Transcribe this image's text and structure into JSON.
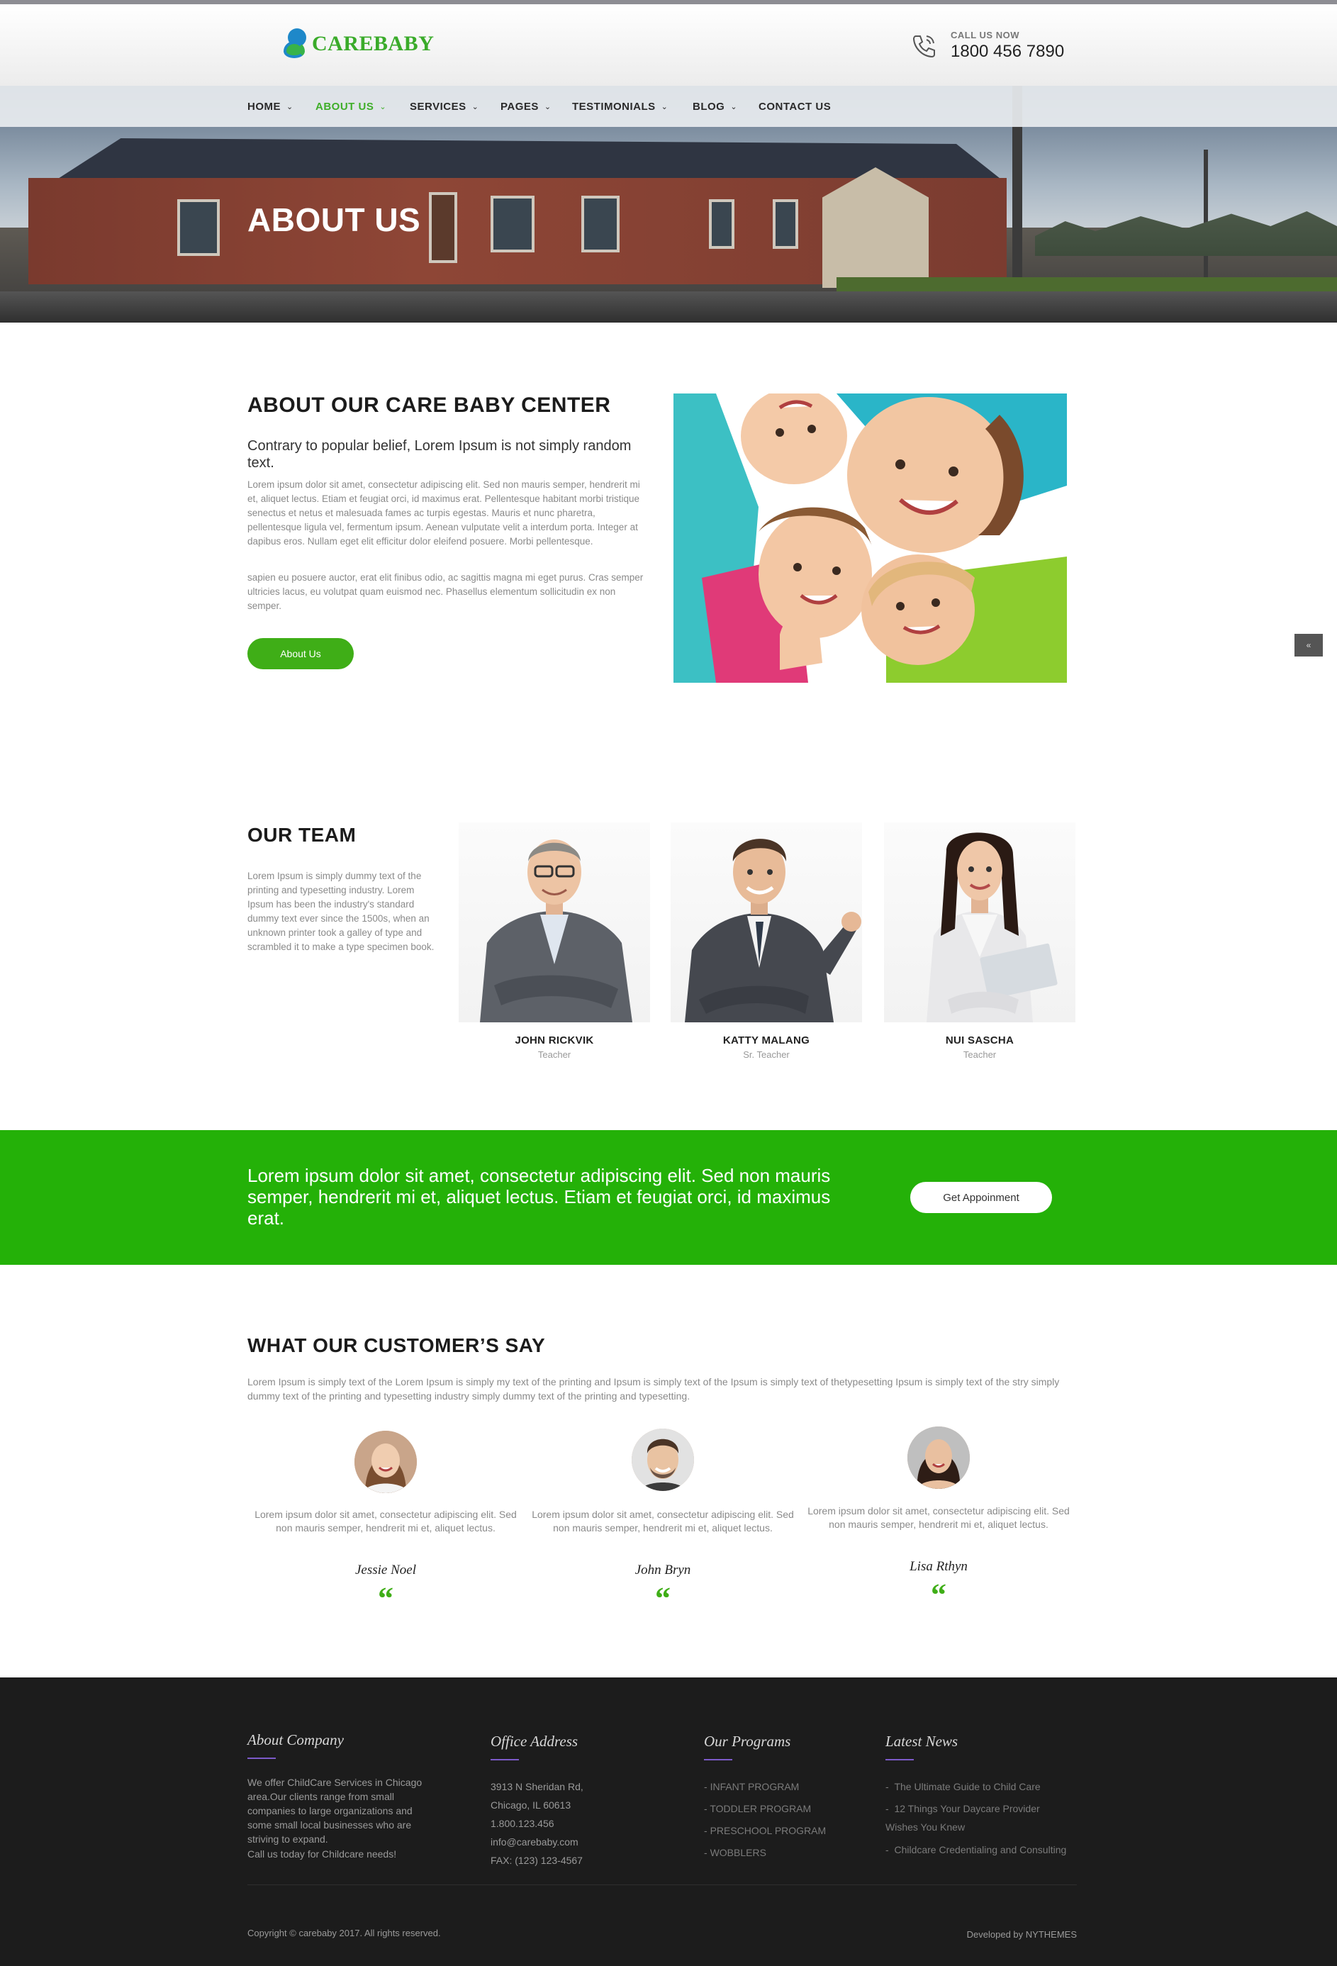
{
  "header": {
    "logo_text": "CAREBABY",
    "call_label": "CALL US NOW",
    "call_number": "1800 456 7890"
  },
  "nav": {
    "items": [
      {
        "label": "HOME",
        "has_dropdown": true
      },
      {
        "label": "ABOUT US",
        "has_dropdown": true,
        "active": true
      },
      {
        "label": "SERVICES",
        "has_dropdown": true
      },
      {
        "label": "PAGES",
        "has_dropdown": true
      },
      {
        "label": "TESTIMONIALS",
        "has_dropdown": true
      },
      {
        "label": "BLOG",
        "has_dropdown": true
      },
      {
        "label": "CONTACT US",
        "has_dropdown": false
      }
    ],
    "dropdown_glyph": "⌄"
  },
  "hero": {
    "title": "ABOUT US"
  },
  "about": {
    "title": "ABOUT OUR CARE BABY CENTER",
    "subtitle": "Contrary to popular belief, Lorem Ipsum is not simply random text.",
    "paragraph1": "Lorem ipsum dolor sit amet, consectetur adipiscing elit. Sed non mauris semper, hendrerit mi et, aliquet lectus. Etiam et feugiat orci, id maximus erat. Pellentesque habitant morbi tristique senectus et netus et malesuada fames ac turpis egestas. Mauris et nunc pharetra, pellentesque ligula vel, fermentum ipsum. Aenean vulputate velit a interdum porta. Integer at dapibus eros. Nullam eget elit efficitur dolor eleifend posuere. Morbi pellentesque.",
    "paragraph2": "sapien eu posuere auctor, erat elit finibus odio, ac sagittis magna mi eget purus. Cras semper ultricies lacus, eu volutpat quam euismod nec. Phasellus elementum sollicitudin ex non semper.",
    "button": "About Us",
    "scroll_top_glyph": "«"
  },
  "team": {
    "title": "OUR TEAM",
    "description": "Lorem Ipsum is simply dummy text of the printing and typesetting industry. Lorem Ipsum has been the industry's standard dummy text ever since the 1500s, when an unknown printer took a galley of type and scrambled it to make a type specimen book.",
    "members": [
      {
        "name": "JOHN RICKVIK",
        "role": "Teacher"
      },
      {
        "name": "KATTY MALANG",
        "role": "Sr. Teacher"
      },
      {
        "name": "NUI SASCHA",
        "role": "Teacher"
      }
    ]
  },
  "cta": {
    "text": "Lorem ipsum dolor sit amet, consectetur adipiscing elit. Sed non mauris semper, hendrerit mi et, aliquet lectus. Etiam et feugiat orci, id maximus erat.",
    "button": "Get Appoinment"
  },
  "testimonials": {
    "title": "WHAT OUR CUSTOMER’S SAY",
    "intro": "Lorem Ipsum is simply text of the Lorem Ipsum is simply my text of the printing and Ipsum is simply text of the Ipsum is simply text of thetypesetting Ipsum is simply text of the stry simply dummy text of the printing and typesetting industry simply dummy text of the printing and typesetting.",
    "items": [
      {
        "text": "Lorem ipsum dolor sit amet, consectetur adipiscing elit. Sed non mauris semper, hendrerit mi et, aliquet lectus.",
        "name": "Jessie Noel"
      },
      {
        "text": "Lorem ipsum dolor sit amet, consectetur adipiscing elit. Sed non mauris semper, hendrerit mi et, aliquet lectus.",
        "name": "John Bryn"
      },
      {
        "text": "Lorem ipsum dolor sit amet, consectetur adipiscing elit. Sed non mauris semper, hendrerit mi et, aliquet lectus.",
        "name": "Lisa Rthyn"
      }
    ],
    "quote_glyph": "“"
  },
  "footer": {
    "about": {
      "title": "About Company",
      "text": "We offer ChildCare Services in Chicago area.Our clients range from small companies to large organizations and some small local businesses who are striving to expand.",
      "cta": "Call us today for Childcare needs!"
    },
    "office": {
      "title": "Office Address",
      "lines": [
        "3913 N Sheridan Rd,",
        "Chicago, IL 60613",
        "1.800.123.456",
        "info@carebaby.com",
        "FAX: (123) 123-4567"
      ]
    },
    "programs": {
      "title": "Our Programs",
      "items": [
        "INFANT PROGRAM",
        "TODDLER PROGRAM",
        "PRESCHOOL PROGRAM",
        "WOBBLERS"
      ]
    },
    "news": {
      "title": "Latest News",
      "items": [
        "The Ultimate Guide to Child Care",
        "12 Things Your Daycare Provider Wishes You Knew",
        "Childcare Credentialing and Consulting"
      ]
    },
    "copyright": "Copyright © carebaby 2017. All rights reserved.",
    "developed_by": "Developed by NYTHEMES"
  },
  "colors": {
    "brand_green": "#3fae17",
    "band_green": "#24b108",
    "footer_bg": "#1c1c1c",
    "accent_purple": "#7c5ac9"
  }
}
